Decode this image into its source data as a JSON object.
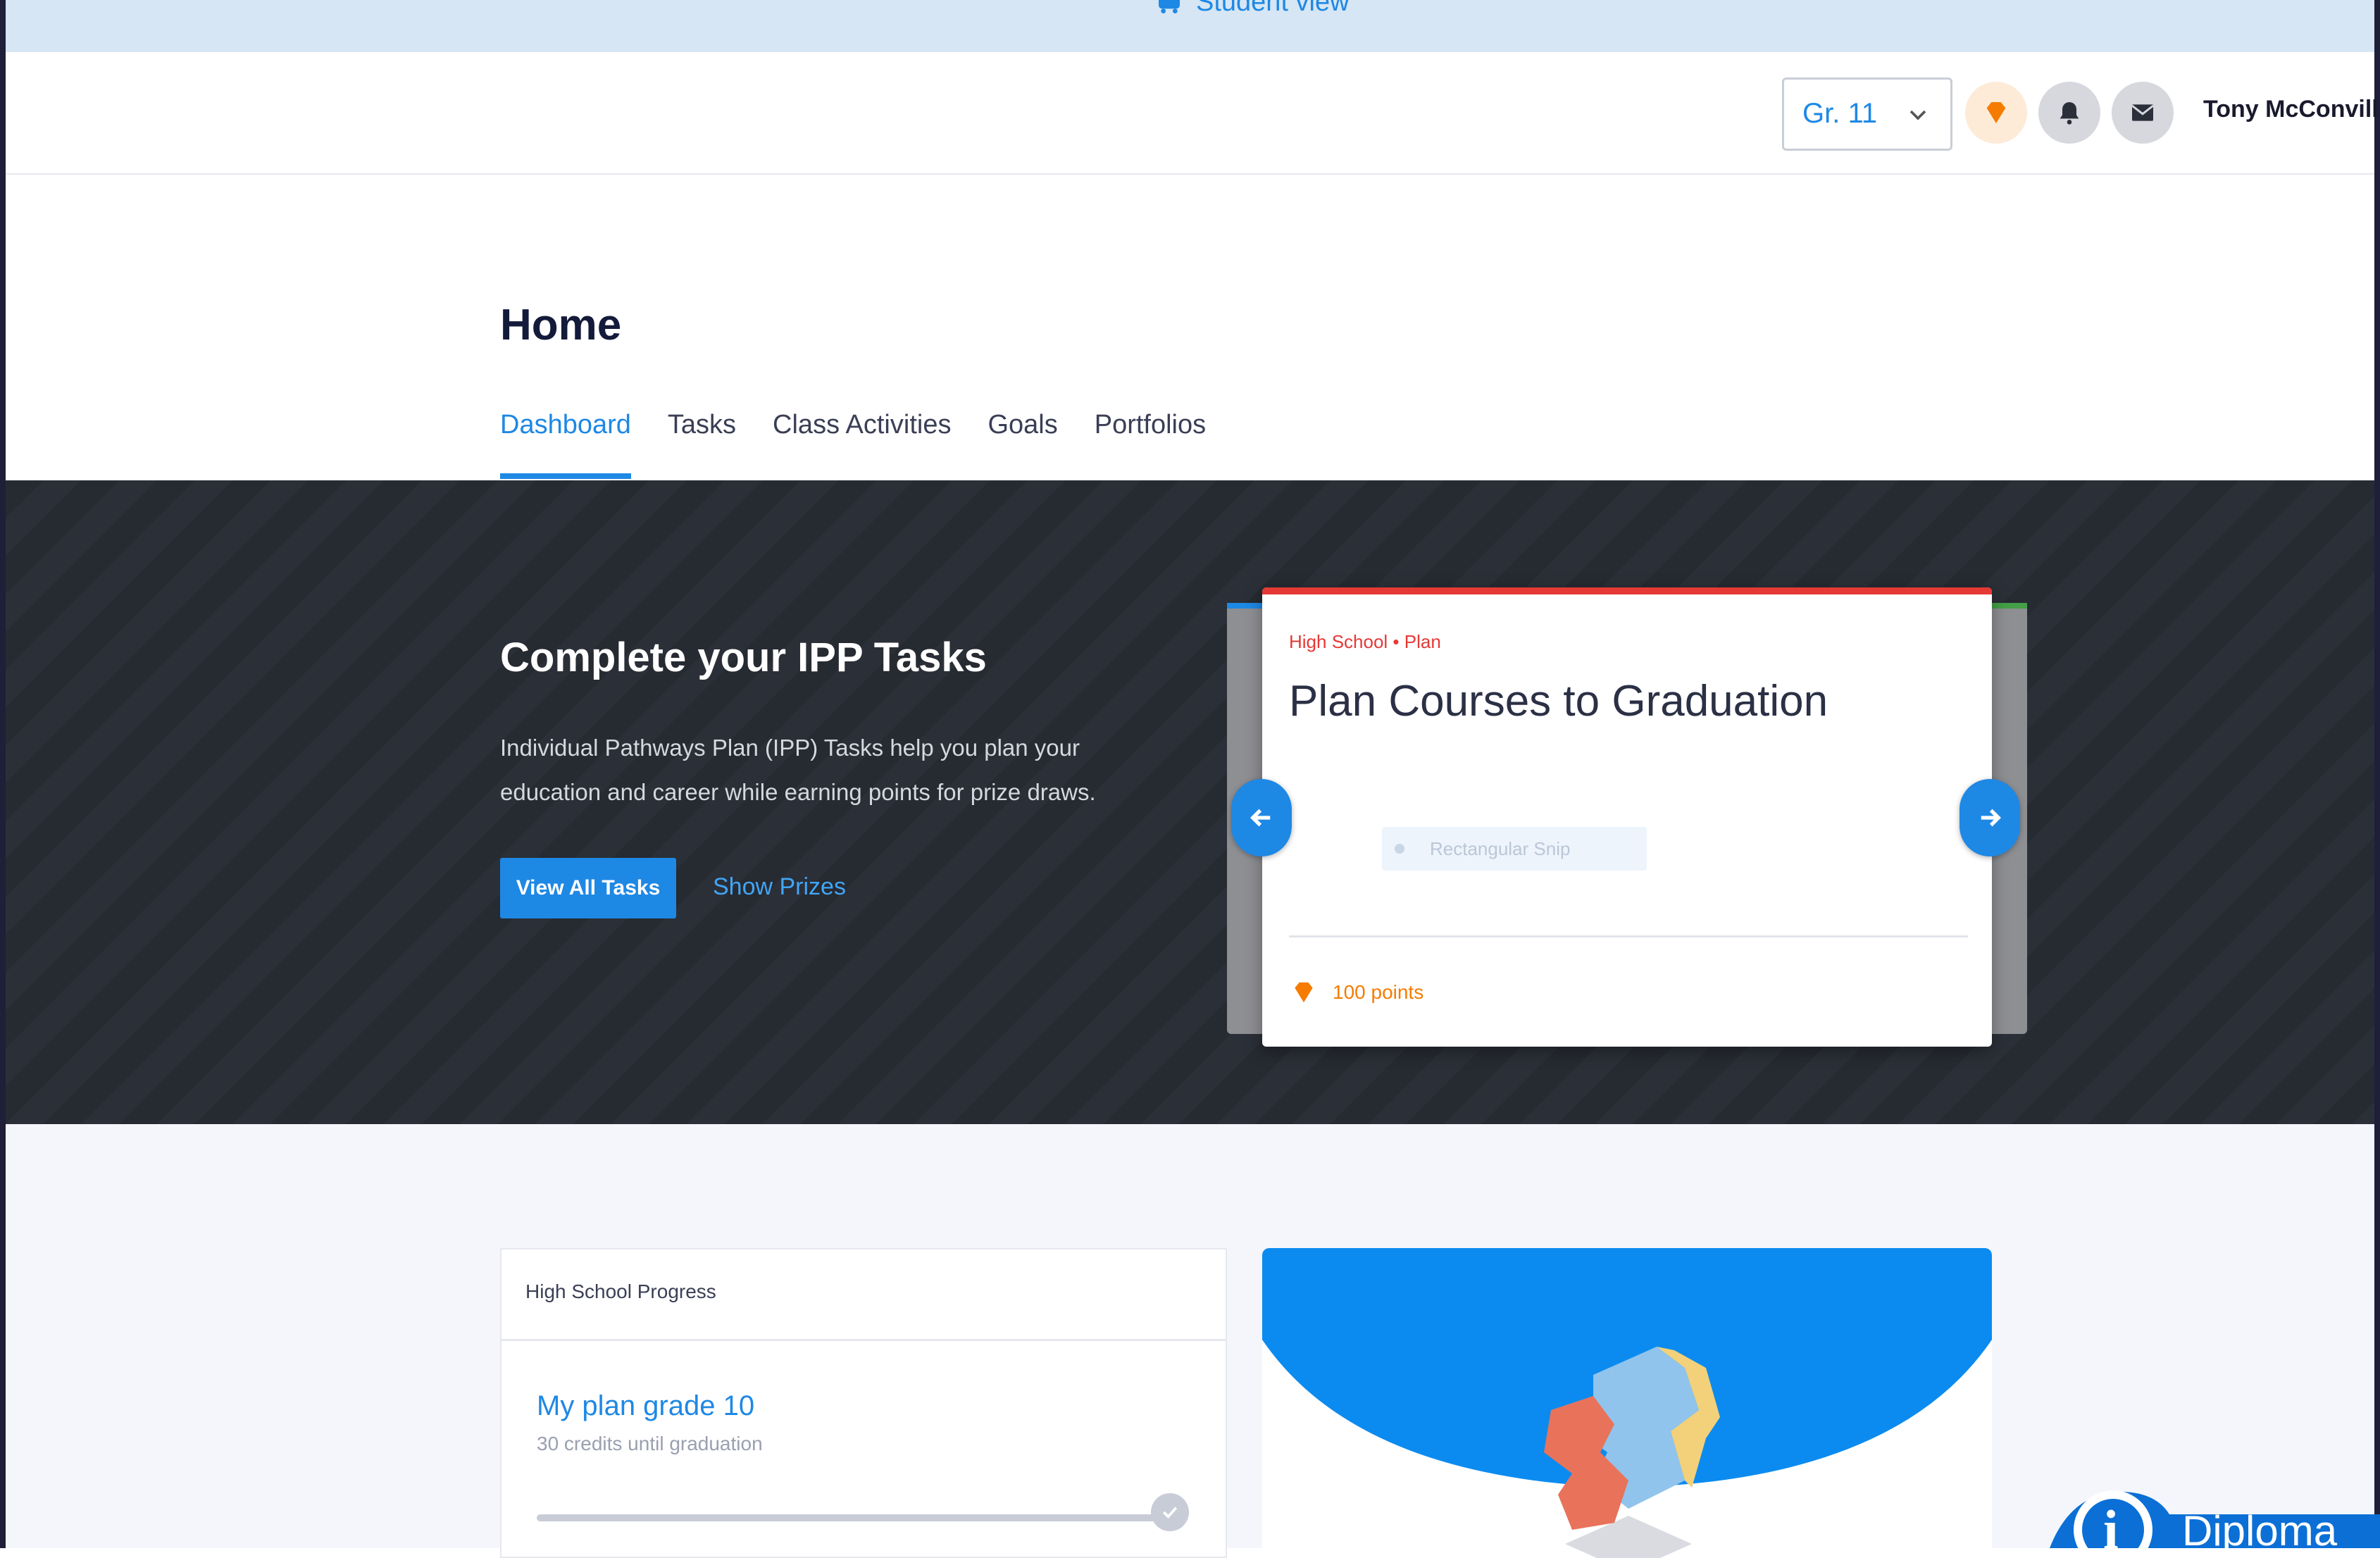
{
  "banner": {
    "label": "Student view",
    "icon": "bus-icon"
  },
  "header": {
    "grade": "Gr. 11",
    "icons": [
      "diamond-icon",
      "bell-icon",
      "mail-icon"
    ],
    "user_name": "Tony McConville"
  },
  "page": {
    "title": "Home",
    "tabs": [
      {
        "label": "Dashboard",
        "active": true
      },
      {
        "label": "Tasks"
      },
      {
        "label": "Class Activities"
      },
      {
        "label": "Goals"
      },
      {
        "label": "Portfolios"
      }
    ]
  },
  "hero": {
    "title": "Complete your IPP Tasks",
    "description": "Individual Pathways Plan (IPP) Tasks help you plan your education and career while earning points for prize draws.",
    "primary_button": "View All Tasks",
    "secondary_link": "Show Prizes"
  },
  "task_card": {
    "category": "High School • Plan",
    "title": "Plan Courses to Graduation",
    "snip_label": "Rectangular Snip",
    "points": "100 points"
  },
  "progress": {
    "header": "High School Progress",
    "plan_title": "My plan grade 10",
    "plan_subtitle": "30 credits until graduation",
    "progress_fraction": 1.0
  },
  "badge": {
    "text": "Diploma",
    "letter": "i"
  },
  "colors": {
    "accent": "#1e88e5",
    "points": "#f57c00",
    "category": "#e53935",
    "hero_bg": "#262a31"
  }
}
